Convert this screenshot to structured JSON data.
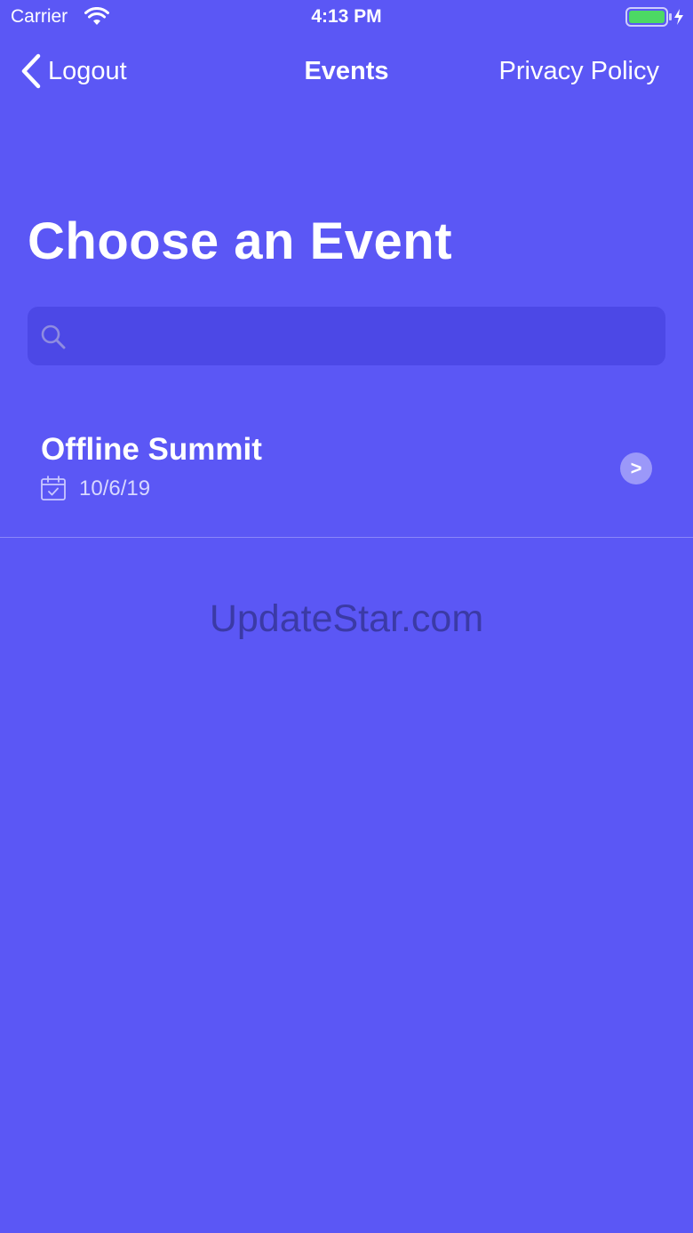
{
  "status_bar": {
    "carrier": "Carrier",
    "time": "4:13 PM",
    "battery_color": "#4cd964"
  },
  "nav": {
    "back_label": "Logout",
    "title": "Events",
    "right_label": "Privacy Policy"
  },
  "page": {
    "title": "Choose an Event",
    "background_color": "#5b57f5"
  },
  "search": {
    "placeholder": "",
    "value": ""
  },
  "events": [
    {
      "name": "Offline Summit",
      "date": "10/6/19"
    }
  ],
  "watermark": "UpdateStar.com"
}
